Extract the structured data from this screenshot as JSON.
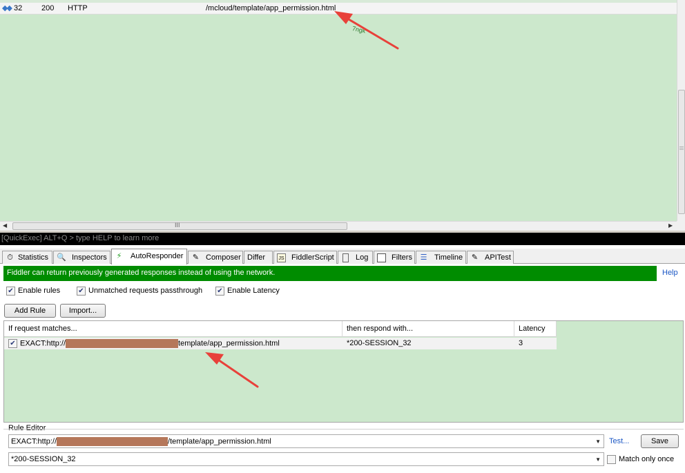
{
  "session_list": {
    "row": {
      "id": "32",
      "status": "200",
      "protocol": "HTTP",
      "url": "/mcloud/template/app_permission.html"
    },
    "annotation_text": "7ngk"
  },
  "quickexec": {
    "placeholder": "[QuickExec] ALT+Q > type HELP to learn more"
  },
  "tabs": [
    {
      "label": "Statistics",
      "icon": "stopwatch-icon"
    },
    {
      "label": "Inspectors",
      "icon": "magnifier-icon"
    },
    {
      "label": "AutoResponder",
      "icon": "lightning-icon",
      "active": true
    },
    {
      "label": "Composer",
      "icon": "pencil-icon"
    },
    {
      "label": "Differ",
      "icon": ""
    },
    {
      "label": "FiddlerScript",
      "icon": "js-file-icon"
    },
    {
      "label": "Log",
      "icon": "log-icon"
    },
    {
      "label": "Filters",
      "icon": "checkbox-icon"
    },
    {
      "label": "Timeline",
      "icon": "timeline-icon"
    },
    {
      "label": "APITest",
      "icon": "api-icon"
    }
  ],
  "autoresponder": {
    "banner": "Fiddler can return previously generated responses instead of using the network.",
    "help": "Help",
    "options": {
      "enable_rules": {
        "label": "Enable rules",
        "checked": true
      },
      "unmatched_passthrough": {
        "label": "Unmatched requests passthrough",
        "checked": true
      },
      "enable_latency": {
        "label": "Enable Latency",
        "checked": true
      }
    },
    "buttons": {
      "add_rule": "Add Rule",
      "import": "Import..."
    },
    "grid": {
      "headers": {
        "match": "If request matches...",
        "respond": "then respond with...",
        "latency": "Latency"
      },
      "rules": [
        {
          "checked": true,
          "match_prefix": "EXACT:http://",
          "match_suffix": "template/app_permission.html",
          "respond": "*200-SESSION_32",
          "latency": "3"
        }
      ]
    },
    "rule_editor": {
      "label": "Rule Editor",
      "match_prefix": "EXACT:http://",
      "match_suffix": "/template/app_permission.html",
      "respond": "*200-SESSION_32",
      "test": "Test...",
      "save": "Save",
      "match_only_once": {
        "label": "Match only once",
        "checked": false
      }
    }
  },
  "colors": {
    "session_bg": "#cce8cc",
    "banner_bg": "#008c00",
    "arrow": "#e8413a",
    "redaction": "#b5775a",
    "link": "#1a56c4"
  }
}
